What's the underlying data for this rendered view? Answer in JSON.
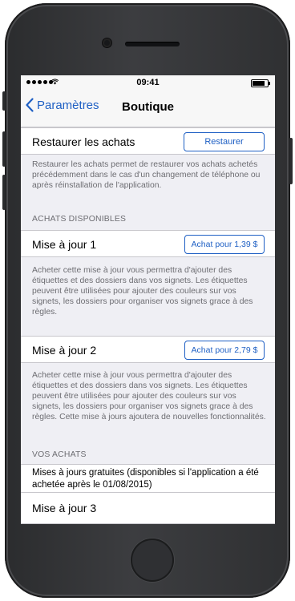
{
  "status": {
    "time": "09:41",
    "battery_level": 0.95
  },
  "nav": {
    "back_label": "Paramètres",
    "title": "Boutique"
  },
  "restore": {
    "label": "Restaurer les achats",
    "button": "Restaurer",
    "footer": "Restaurer les achats permet de restaurer vos achats achetés précédemment dans le cas d'un changement de téléphone ou après réinstallation de l'application."
  },
  "available": {
    "header": "ACHATS DISPONIBLES",
    "items": [
      {
        "label": "Mise à jour 1",
        "button": "Achat pour 1,39 $",
        "description": "Acheter cette mise à jour vous permettra d'ajouter des étiquettes et des dossiers dans vos signets. Les étiquettes peuvent être utilisées pour ajouter des couleurs sur vos signets, les dossiers pour organiser vos signets grace à des règles."
      },
      {
        "label": "Mise à jour 2",
        "button": "Achat pour 2,79 $",
        "description": "Acheter cette mise à jour vous permettra d'ajouter des étiquettes et des dossiers dans vos signets. Les étiquettes peuvent être utilisées pour ajouter des couleurs sur vos signets, les dossiers pour organiser vos signets grace à des règles. Cette mise à jours ajoutera de nouvelles fonctionnalités."
      }
    ]
  },
  "purchased": {
    "header": "VOS ACHATS",
    "note": "Mises à jours gratuites (disponibles si l'application a été  achetée après le 01/08/2015)",
    "items": [
      "Mise à jour 3"
    ]
  },
  "colors": {
    "accent": "#1f60c4",
    "background": "#efeff4",
    "footer_text": "#6d6d72"
  }
}
